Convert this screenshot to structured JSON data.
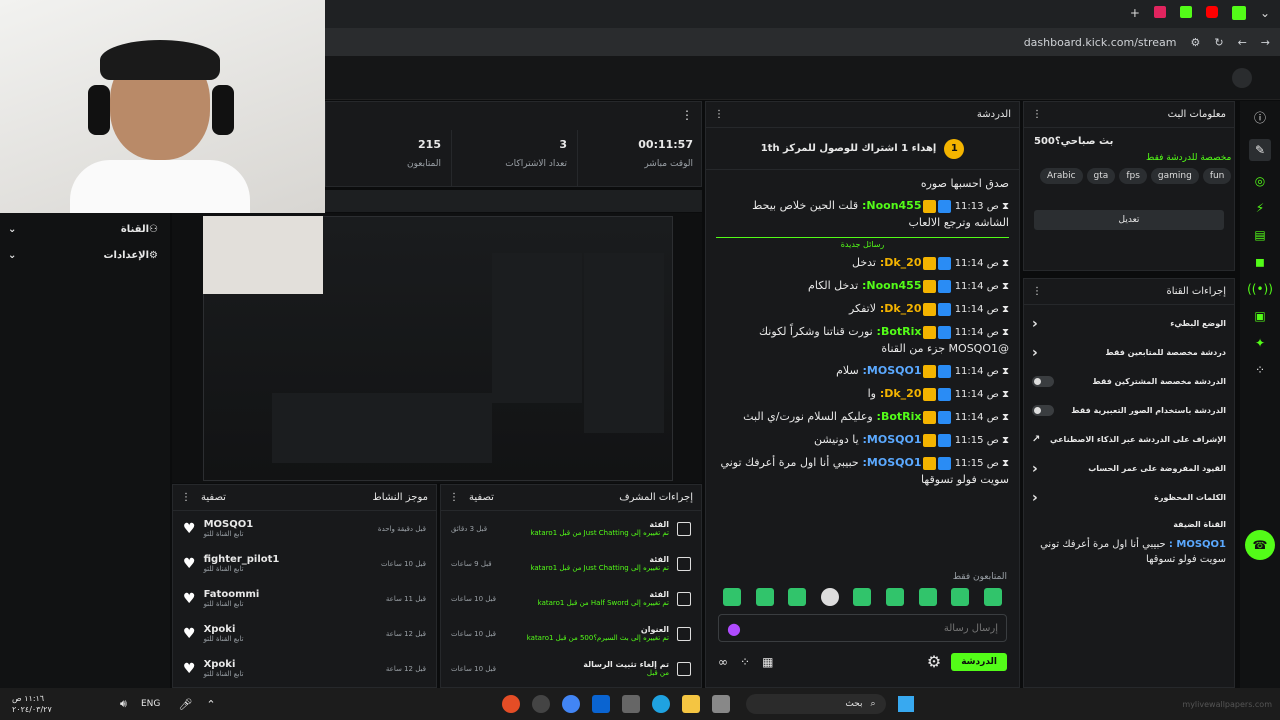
{
  "browser": {
    "url": "dashboard.kick.com/stream"
  },
  "stats": [
    {
      "value": "215",
      "label": "المتابعون"
    },
    {
      "value": "3",
      "label": "تعداد الاشتراكات"
    },
    {
      "value": "00:11:57",
      "label": "الوقت مباشر"
    }
  ],
  "left_menu": [
    {
      "label": "القناة"
    },
    {
      "label": "الإعدادات"
    }
  ],
  "chat": {
    "title": "الدردشة",
    "goal": "إهداء 1 اشتراك للوصول للمركز 1th",
    "goal_rank": "1",
    "new_messages_label": "رسائل جديدة",
    "messages": [
      {
        "time": "",
        "user": "",
        "text": "صدق احسبها صوره",
        "color": "#53fc18"
      },
      {
        "time": "ص 11:13",
        "user": "Noon455:",
        "text": "قلت الحين خلاص بيحط الشاشه وترجع الالعاب",
        "color": "#53fc18"
      },
      {
        "time": "ص 11:14",
        "user": "Dk_20:",
        "text": "تدخل",
        "color": "#f4b400"
      },
      {
        "time": "ص 11:14",
        "user": "Noon455:",
        "text": "تدخل الكام",
        "color": "#53fc18"
      },
      {
        "time": "ص 11:14",
        "user": "Dk_20:",
        "text": "لاتفكر",
        "color": "#f4b400"
      },
      {
        "time": "ص 11:14",
        "user": "BotRix:",
        "text": "نورت قناتنا وشكراً لكونك @MOSQO1 جزء من القناة",
        "color": "#53fc18"
      },
      {
        "time": "ص 11:14",
        "user": "MOSQO1:",
        "text": "سلام",
        "color": "#5ba9ff"
      },
      {
        "time": "ص 11:14",
        "user": "Dk_20:",
        "text": "وا",
        "color": "#f4b400"
      },
      {
        "time": "ص 11:14",
        "user": "BotRix:",
        "text": "وعليكم السلام نورت/ي البث",
        "color": "#53fc18"
      },
      {
        "time": "ص 11:15",
        "user": "MOSQO1:",
        "text": "يا دونيشن",
        "color": "#5ba9ff"
      },
      {
        "time": "ص 11:15",
        "user": "MOSQO1:",
        "text": "حبيبي أنا اول مرة أعرفك توني سويت فولو تسوقها",
        "color": "#5ba9ff"
      }
    ],
    "followers_only": "المتابعون فقط",
    "input_placeholder": "إرسال رسالة",
    "send_label": "الدردشة"
  },
  "stream_info": {
    "title": "معلومات البث",
    "stream_title": "بث صباحي؟500",
    "category": "مخصصة للدردشة فقط",
    "tags": [
      "Arabic",
      "gta",
      "fps",
      "gaming",
      "fun"
    ],
    "edit_label": "تعديل"
  },
  "channel_actions": {
    "title": "إجراءات القناة",
    "items": [
      {
        "label": "الوضع البطيء",
        "kind": "arrow"
      },
      {
        "label": "دردشة مخصصة للمتابعين فقط",
        "kind": "arrow"
      },
      {
        "label": "الدردشة مخصصة المشتركين فقط",
        "kind": "toggle"
      },
      {
        "label": "الدردشة باستخدام الصور التعبيرية فقط",
        "kind": "toggle"
      },
      {
        "label": "الإشراف على الدردشة عبر الذكاء الاصطناعي",
        "kind": "link"
      },
      {
        "label": "القيود المفروضة على عمر الحساب",
        "kind": "arrow"
      },
      {
        "label": "الكلمات المحظورة",
        "kind": "arrow"
      }
    ],
    "guest_channel": "القناة الضيفة",
    "overlay_user": "MOSQO1 :",
    "overlay_text": "حبيبي أنا اول مرة أعرفك توني سويت فولو تسوقها"
  },
  "activity_feed": {
    "title": "موجز النشاط",
    "filter": "تصفية",
    "items": [
      {
        "user": "MOSQO1",
        "sub": "تابع القناة للتو",
        "time": "قبل دقيقة واحدة"
      },
      {
        "user": "fighter_pilot1",
        "sub": "تابع القناة للتو",
        "time": "قبل 10 ساعات"
      },
      {
        "user": "Fatoommi",
        "sub": "تابع القناة للتو",
        "time": "قبل 11 ساعة"
      },
      {
        "user": "Xpoki",
        "sub": "تابع القناة للتو",
        "time": "قبل 12 ساعة"
      },
      {
        "user": "Xpoki",
        "sub": "تابع القناة للتو",
        "time": "قبل 12 ساعة"
      }
    ]
  },
  "mod_actions": {
    "title": "إجراءات المشرف",
    "filter": "تصفية",
    "items": [
      {
        "head": "الفئة",
        "detail": "تم تغييره إلى Just Chatting من قبل kataro1",
        "time": "قبل 3 دقائق"
      },
      {
        "head": "الفئة",
        "detail": "تم تغييره إلى Just Chatting من قبل kataro1",
        "time": "قبل 9 ساعات"
      },
      {
        "head": "الفئة",
        "detail": "تم تغييره إلى Half Sword من قبل kataro1",
        "time": "قبل 10 ساعات"
      },
      {
        "head": "العنوان",
        "detail": "تم تغييره إلى بث السيرم؟500 من قبل kataro1",
        "time": "قبل 10 ساعات"
      },
      {
        "head": "تم إلغاء تثبيت الرسالة",
        "detail": "من قبل",
        "time": "قبل 10 ساعات"
      }
    ]
  },
  "taskbar": {
    "search": "بحث",
    "lang": "ENG",
    "time": "١١:١٦ ص",
    "date": "٢٠٢٤/٠٣/٢٧",
    "watermark": "mylivewallpapers.com"
  }
}
